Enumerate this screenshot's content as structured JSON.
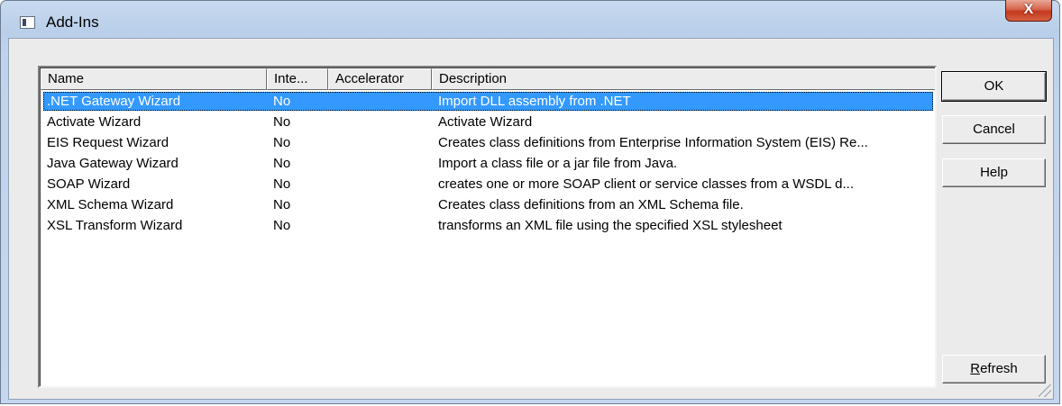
{
  "window": {
    "title": "Add-Ins",
    "close_glyph": "X"
  },
  "list": {
    "columns": [
      "Name",
      "Inte...",
      "Accelerator",
      "Description"
    ],
    "rows": [
      {
        "name": ".NET Gateway Wizard",
        "interactive": "No",
        "accelerator": "",
        "description": "Import DLL assembly from .NET",
        "selected": true
      },
      {
        "name": "Activate Wizard",
        "interactive": "No",
        "accelerator": "",
        "description": "Activate Wizard"
      },
      {
        "name": "EIS Request Wizard",
        "interactive": "No",
        "accelerator": "",
        "description": "Creates class definitions from Enterprise Information System (EIS) Re..."
      },
      {
        "name": "Java Gateway Wizard",
        "interactive": "No",
        "accelerator": "",
        "description": "Import a class file or a jar file from Java."
      },
      {
        "name": "SOAP Wizard",
        "interactive": "No",
        "accelerator": "",
        "description": "creates one or more SOAP client or service classes from a WSDL d..."
      },
      {
        "name": "XML Schema Wizard",
        "interactive": "No",
        "accelerator": "",
        "description": "Creates class definitions from an XML Schema file."
      },
      {
        "name": "XSL Transform Wizard",
        "interactive": "No",
        "accelerator": "",
        "description": "transforms an XML file using the specified XSL stylesheet"
      }
    ]
  },
  "buttons": {
    "ok": "OK",
    "cancel": "Cancel",
    "help": "Help",
    "refresh_first": "R",
    "refresh_rest": "efresh"
  },
  "colors": {
    "selection": "#3399ff",
    "close_button": "#c7452b",
    "frame": "#bfd3ec"
  },
  "icons": {
    "app": "window-app-icon",
    "close": "close-icon",
    "grip": "resize-grip-icon"
  }
}
